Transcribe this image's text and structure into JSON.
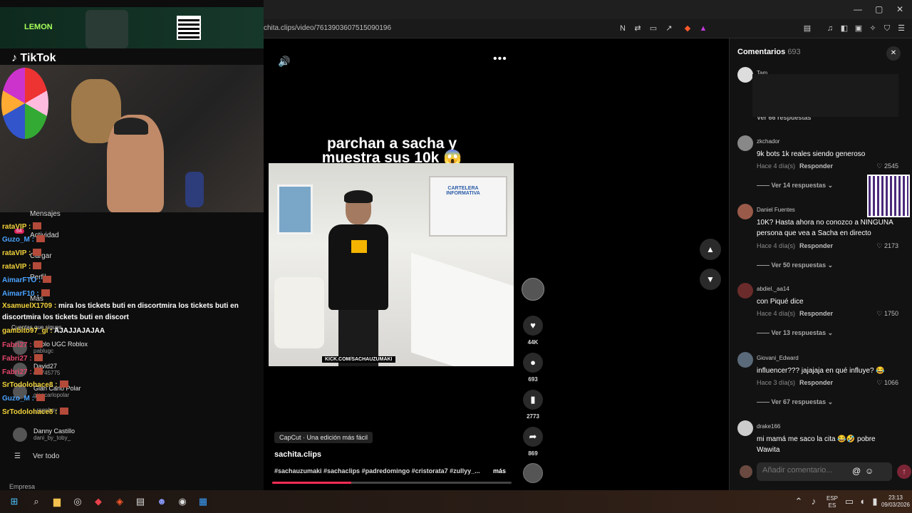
{
  "browser": {
    "url": "chita.clips/video/7613903607515090196",
    "window_controls": [
      "—",
      "▢",
      "✕"
    ]
  },
  "overlay": {
    "lemon_label": "LEMON",
    "tiktok_label": "TikTok",
    "chat": [
      {
        "nick": "rataVIP :",
        "msg": "",
        "color": "y"
      },
      {
        "nick": "Guzo_M :",
        "msg": "",
        "color": "b"
      },
      {
        "nick": "rataVIP :",
        "msg": "",
        "color": "y"
      },
      {
        "nick": "rataVIP :",
        "msg": "",
        "color": "y"
      },
      {
        "nick": "AimarFTO :",
        "msg": "",
        "color": "b"
      },
      {
        "nick": "AimarF10 :",
        "msg": "",
        "color": "b"
      },
      {
        "nick": "XsamuelX1709 :",
        "msg": "mira los tickets buti en discortmira los tickets buti en",
        "color": "y"
      },
      {
        "nick": "",
        "msg": "discortmira los tickets buti en discort",
        "color": "w"
      },
      {
        "nick": "gambito97_gi :",
        "msg": "AJAJJAJAJAA",
        "color": "y"
      },
      {
        "nick": "Fabri27 :",
        "msg": "",
        "color": "r"
      },
      {
        "nick": "Fabri27 :",
        "msg": "",
        "color": "r"
      },
      {
        "nick": "Fabri27 :",
        "msg": "",
        "color": "r"
      },
      {
        "nick": "SrTodolohace8 :",
        "msg": "",
        "color": "y"
      },
      {
        "nick": "Guzo_M :",
        "msg": "",
        "color": "b"
      },
      {
        "nick": "SrTodolohace8 :",
        "msg": "",
        "color": "y"
      }
    ],
    "menu": {
      "mensajes": "Mensajes",
      "actividad": "Actividad",
      "cargar": "Cargar",
      "perfil": "Perfil",
      "mas": "Más",
      "following_title": "Cuentas que sigues",
      "ver_todo": "Ver todo",
      "empresa": "Empresa",
      "activity_badge": "64"
    },
    "following": [
      {
        "name": "Pablo UGC Roblox",
        "handle": "pablugc"
      },
      {
        "name": "David27",
        "handle": "dal745775"
      },
      {
        "name": "Gian Carlo Polar",
        "handle": "giancarlopolar"
      },
      {
        "name": "",
        "handle": "_rageboy"
      },
      {
        "name": "Danny Castillo",
        "handle": "dani_by_toby_"
      }
    ]
  },
  "video": {
    "overlay_text": "parchan a sacha y muestra sus 10k 😱",
    "board_text": "CARTELERA INFORMATIVA",
    "kick_tag": "KICK.COM/SACHAUZUMAKI",
    "capcut_label": "CapCut · Una edición más fácil",
    "author": "sachita.clips",
    "hashtags": "#sachauzumaki #sachaclips #padredomingo #cristorata7 #zullyy_...",
    "more_label": "más",
    "progress": 0.33
  },
  "actions": {
    "likes": "44K",
    "comments": "693",
    "saves": "2773",
    "shares": "869"
  },
  "comments_panel": {
    "title": "Comentarios",
    "count": "693",
    "input_placeholder": "Añadir comentario...",
    "items": [
      {
        "user": "Tam",
        "text": "",
        "meta": "",
        "reply": "",
        "likes": "",
        "more": "Ver 66 respuestas"
      },
      {
        "user": "zkchador",
        "text": "9k bots 1k reales siendo generoso",
        "meta": "Hace 4 día(s)",
        "reply": "Responder",
        "likes": "2545",
        "more": "Ver 14 respuestas"
      },
      {
        "user": "Daniel Fuentes",
        "text": "10K? Hasta ahora no conozco a NINGUNA persona que vea a Sacha en directo",
        "meta": "Hace 4 día(s)",
        "reply": "Responder",
        "likes": "2173",
        "more": "Ver 50 respuestas"
      },
      {
        "user": "abdiel._aa14",
        "text": "con Piqué dice",
        "meta": "Hace 4 día(s)",
        "reply": "Responder",
        "likes": "1750",
        "more": "Ver 13 respuestas"
      },
      {
        "user": "Giovani_Edward",
        "text": "influencer??? jajajaja en qué influye? 😂",
        "meta": "Hace 3 día(s)",
        "reply": "Responder",
        "likes": "1066",
        "more": "Ver 67 respuestas"
      },
      {
        "user": "drake166",
        "text": "mi mamá me saco la cita 😂🤣 pobre Wawita",
        "meta": "",
        "reply": "",
        "likes": "",
        "more": ""
      }
    ]
  },
  "taskbar": {
    "lang_top": "ESP",
    "lang_bottom": "ES",
    "time": "23:13",
    "date": "09/03/2026"
  }
}
